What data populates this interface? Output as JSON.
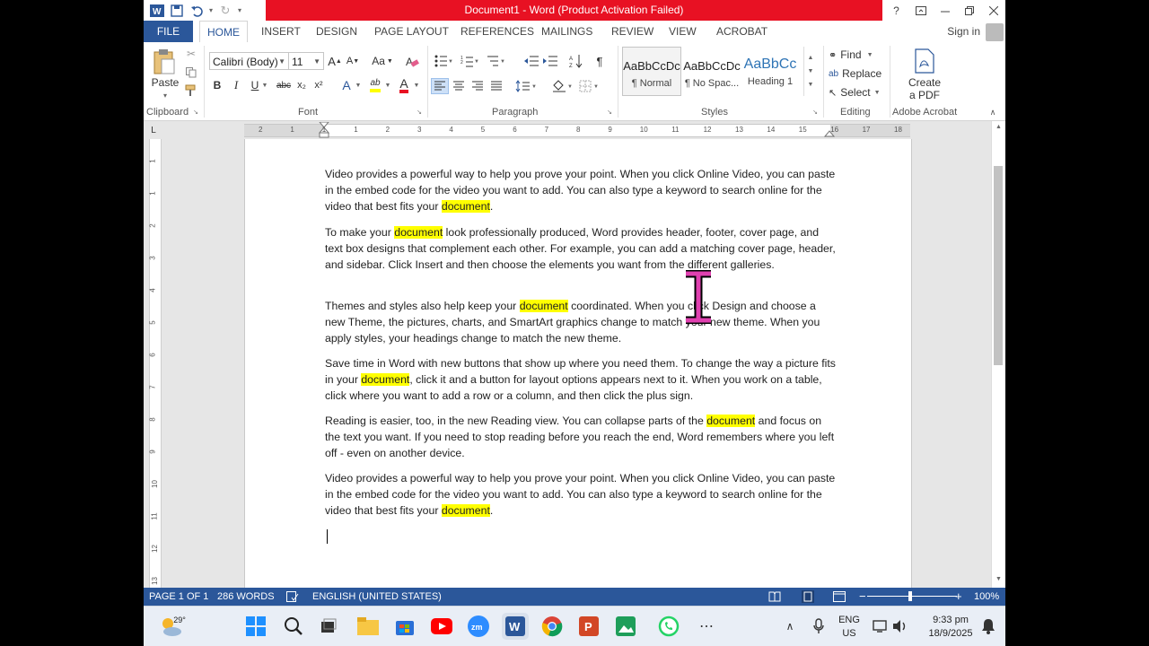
{
  "window": {
    "title": "Document1 - Word (Product Activation Failed)",
    "help": "?",
    "sign_in": "Sign in"
  },
  "tabs": [
    {
      "label": "FILE"
    },
    {
      "label": "HOME"
    },
    {
      "label": "INSERT"
    },
    {
      "label": "DESIGN"
    },
    {
      "label": "PAGE LAYOUT"
    },
    {
      "label": "REFERENCES"
    },
    {
      "label": "MAILINGS"
    },
    {
      "label": "REVIEW"
    },
    {
      "label": "VIEW"
    },
    {
      "label": "ACROBAT"
    }
  ],
  "ribbon": {
    "clipboard": {
      "label": "Clipboard",
      "paste": "Paste"
    },
    "font": {
      "label": "Font",
      "family": "Calibri (Body)",
      "size": "11",
      "bold": "B",
      "italic": "I",
      "underline": "U",
      "strike": "abc",
      "subscript": "x₂",
      "superscript": "x²",
      "grow": "A",
      "shrink": "A",
      "case": "Aa",
      "effects": "A",
      "highlight": "ab",
      "color": "A"
    },
    "paragraph": {
      "label": "Paragraph",
      "pilcrow": "¶"
    },
    "styles": {
      "label": "Styles",
      "items": [
        {
          "preview": "AaBbCcDc",
          "name": "¶ Normal"
        },
        {
          "preview": "AaBbCcDc",
          "name": "¶ No Spac..."
        },
        {
          "preview": "AaBbCc",
          "name": "Heading 1"
        }
      ]
    },
    "editing": {
      "label": "Editing",
      "find": "Find",
      "replace": "Replace",
      "select": "Select"
    },
    "acrobat": {
      "label": "Adobe Acrobat",
      "create_line1": "Create",
      "create_line2": "a PDF"
    }
  },
  "ruler": {
    "ticks": [
      "2",
      "1",
      "1",
      "1",
      "2",
      "3",
      "4",
      "5",
      "6",
      "7",
      "8",
      "9",
      "10",
      "11",
      "12",
      "13",
      "14",
      "15",
      "16",
      "17",
      "18"
    ],
    "vticks": [
      "1",
      "1",
      "2",
      "3",
      "4",
      "5",
      "6",
      "7",
      "8",
      "9",
      "10",
      "11",
      "12",
      "13"
    ],
    "tab_marker": "L"
  },
  "document": {
    "paragraphs": [
      {
        "t1": "Video provides a powerful way to help you prove your point. When you click Online Video, you can paste in the embed code for the video you want to add. You can also type a keyword to search online for the video that best fits your ",
        "h": "document",
        "t2": "."
      },
      {
        "t1": "To make your ",
        "h": "document",
        "t2": " look professionally produced, Word provides header, footer, cover page, and text box designs that complement each other. For example, you can add a matching cover page, header, and sidebar. Click Insert and then choose the elements you want from the different galleries."
      },
      {
        "t1": "Themes and styles also help keep your ",
        "h": "document",
        "t2": " coordinated. When you click Design and choose a new Theme, the pictures, charts, and SmartArt graphics change to match your new theme. When you apply styles, your headings change to match the new theme."
      },
      {
        "t1": "Save time in Word with new buttons that show up where you need them. To change the way a picture fits in your ",
        "h": "document",
        "t2": ", click it and a button for layout options appears next to it. When you work on a table, click where you want to add a row or a column, and then click the plus sign."
      },
      {
        "t1": "Reading is easier, too, in the new Reading view. You can collapse parts of the ",
        "h": "document",
        "t2": " and focus on the text you want. If you need to stop reading before you reach the end, Word remembers where you left off - even on another device."
      },
      {
        "t1": "Video provides a powerful way to help you prove your point. When you click Online Video, you can paste in the embed code for the video you want to add. You can also type a keyword to search online for the video that best fits your ",
        "h": "document",
        "t2": "."
      }
    ]
  },
  "status": {
    "page": "PAGE 1 OF 1",
    "words": "286 WORDS",
    "language": "ENGLISH (UNITED STATES)",
    "zoom": "100%"
  },
  "taskbar": {
    "weather": "29°",
    "lang1": "ENG",
    "lang2": "US",
    "time": "9:33 pm",
    "date": "18/9/2025"
  },
  "colors": {
    "word_blue": "#2b579a",
    "title_red": "#e81123",
    "highlight": "#ffff00"
  }
}
